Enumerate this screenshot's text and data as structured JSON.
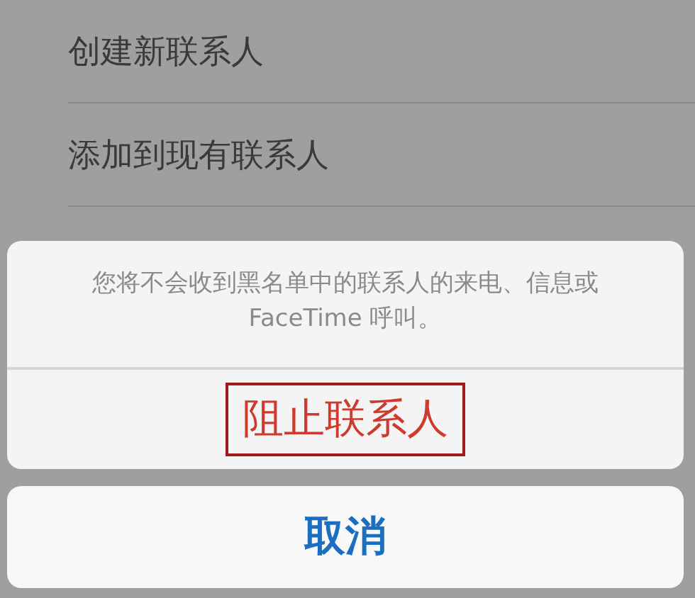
{
  "background_list": [
    {
      "label": "创建新联系人"
    },
    {
      "label": "添加到现有联系人"
    }
  ],
  "action_sheet": {
    "message": "您将不会收到黑名单中的联系人的来电、信息或 FaceTime 呼叫。",
    "actions": [
      {
        "label": "阻止联系人",
        "kind": "destructive",
        "highlighted": true
      }
    ],
    "cancel": {
      "label": "取消"
    }
  }
}
